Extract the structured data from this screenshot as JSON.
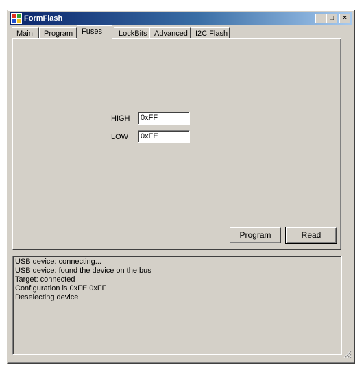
{
  "window": {
    "title": "FormFlash",
    "minimize_glyph": "_",
    "maximize_glyph": "□",
    "close_glyph": "×"
  },
  "tabs": [
    {
      "label": "Main"
    },
    {
      "label": "Program"
    },
    {
      "label": "Fuses",
      "active": true
    },
    {
      "label": "LockBits"
    },
    {
      "label": "Advanced"
    },
    {
      "label": "I2C Flash"
    }
  ],
  "fuses": {
    "high_label": "HIGH",
    "high_value": "0xFF",
    "low_label": "LOW",
    "low_value": "0xFE",
    "program_button": "Program",
    "read_button": "Read"
  },
  "log": {
    "lines": [
      "USB device: connecting...",
      "USB device: found the device on the bus",
      "Target: connected",
      "Configuration is 0xFE 0xFF",
      "Deselecting device"
    ]
  },
  "icons": {
    "app": "formflash-app-icon",
    "grip": "resize-grip-icon"
  },
  "colors": {
    "titlebar_start": "#0a246a",
    "titlebar_end": "#a6caf0",
    "face": "#d4d0c8"
  }
}
